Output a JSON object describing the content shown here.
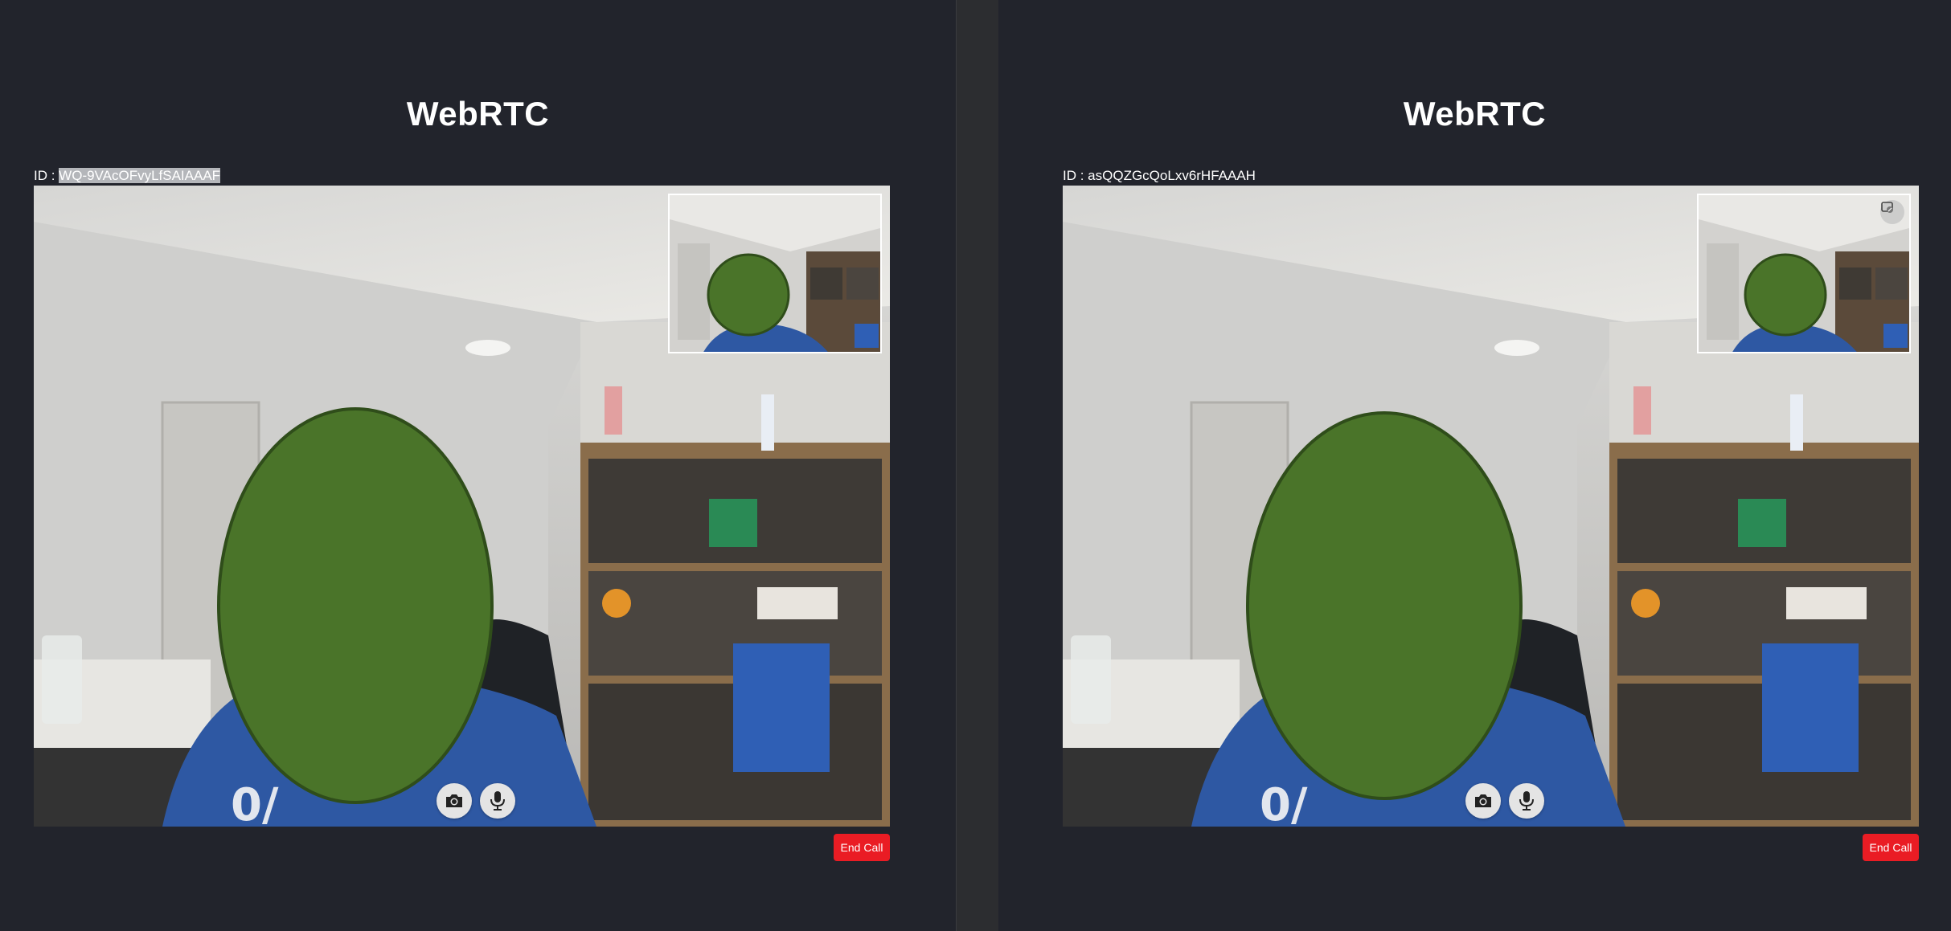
{
  "panes": [
    {
      "title": "WebRTC",
      "id_label": "ID : ",
      "id_value": "WQ-9VAcOFvyLfSAIAAAF",
      "end_call_label": "End Call"
    },
    {
      "title": "WebRTC",
      "id_label": "ID : ",
      "id_value": "asQQZGcQoLxv6rHFAAAH",
      "end_call_label": "End Call"
    }
  ],
  "controls": [
    "camera-icon",
    "microphone-icon"
  ],
  "colors": {
    "background": "#22242c",
    "end_call": "#ea1c24",
    "face_mask": "#4a7429"
  }
}
